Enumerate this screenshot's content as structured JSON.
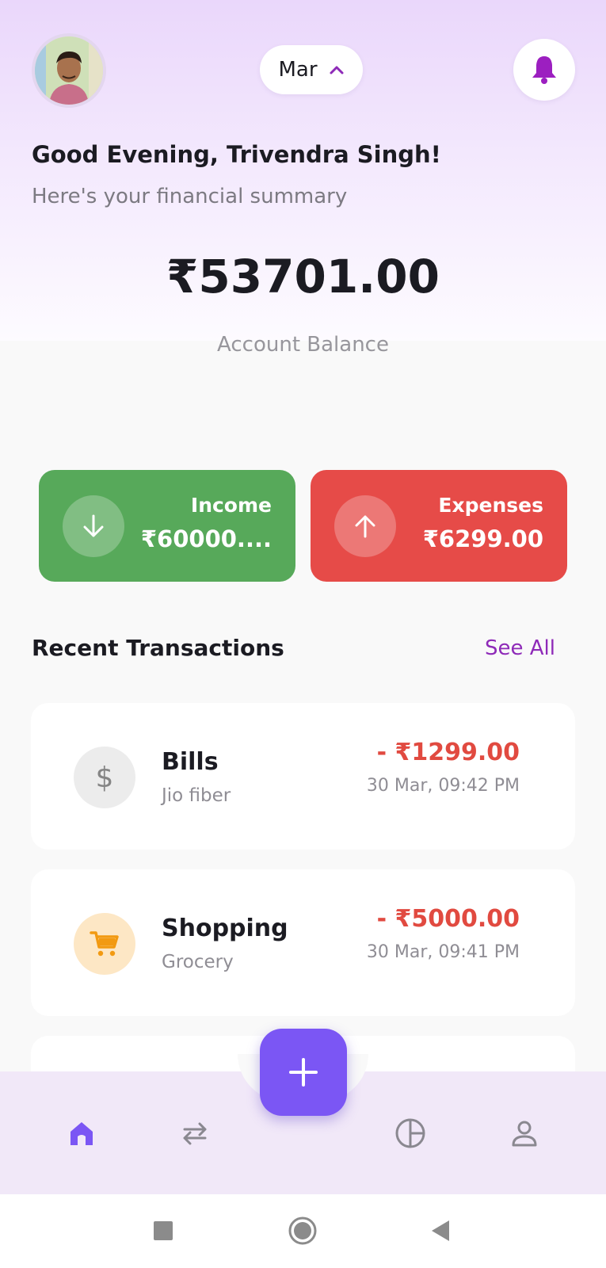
{
  "header": {
    "month_selector": {
      "label": "Mar",
      "icon": "chevron-up-icon"
    },
    "notification_icon": "bell-icon"
  },
  "greeting": {
    "title": "Good Evening, Trivendra Singh!",
    "subtitle": "Here's your financial summary"
  },
  "balance": {
    "amount": "₹53701.00",
    "label": "Account Balance"
  },
  "stats": {
    "income": {
      "label": "Income",
      "amount": "₹60000....",
      "icon": "arrow-down-icon",
      "color": "#57a95a"
    },
    "expenses": {
      "label": "Expenses",
      "amount": "₹6299.00",
      "icon": "arrow-up-icon",
      "color": "#e64b48"
    }
  },
  "recent": {
    "title": "Recent Transactions",
    "see_all": "See All",
    "items": [
      {
        "category": "Bills",
        "description": "Jio fiber",
        "amount": "- ₹1299.00",
        "time": "30 Mar, 09:42 PM",
        "icon": "dollar-icon",
        "icon_symbol": "$"
      },
      {
        "category": "Shopping",
        "description": "Grocery",
        "amount": "- ₹5000.00",
        "time": "30 Mar, 09:41 PM",
        "icon": "shopping-cart-icon"
      }
    ]
  },
  "bottom_nav": {
    "items": [
      "home-icon",
      "transactions-swap-icon",
      "budget-pie-icon",
      "profile-icon"
    ],
    "fab_icon": "plus-icon",
    "active_color": "#7b56f4"
  },
  "system_nav": [
    "recents-square-icon",
    "home-circle-icon",
    "back-triangle-icon"
  ],
  "colors": {
    "accent": "#7b56f4",
    "see_all": "#8e2ab8",
    "expense_text": "#e14a40"
  }
}
